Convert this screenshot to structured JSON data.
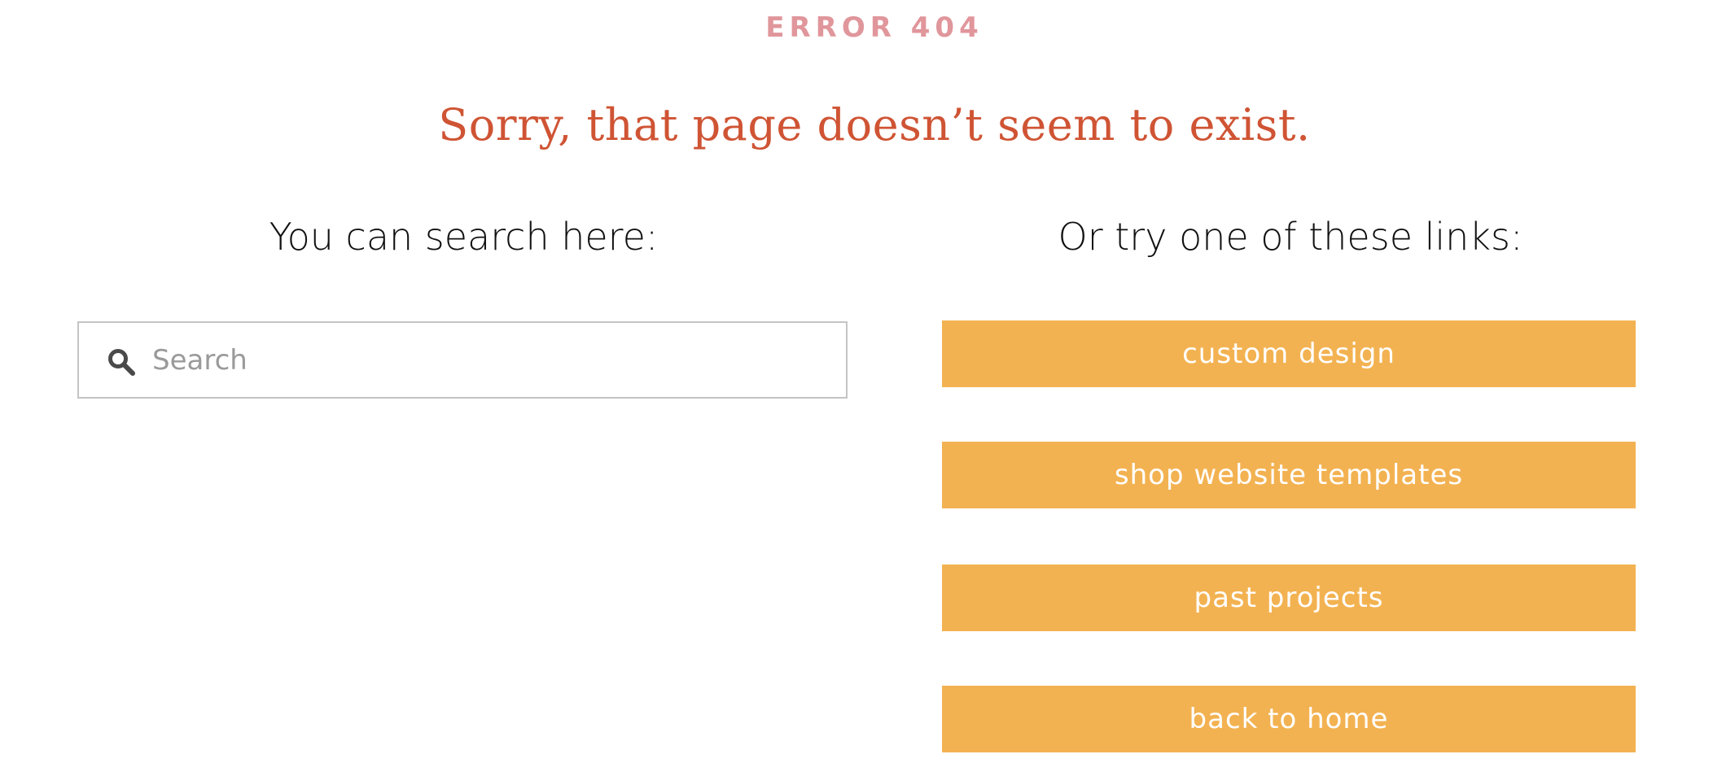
{
  "error": {
    "code_label": "ERROR 404"
  },
  "headline": "Sorry, that page doesn’t seem to exist.",
  "search_section": {
    "heading": "You can search here:",
    "placeholder": "Search",
    "value": "",
    "icon": "search-icon"
  },
  "links_section": {
    "heading": "Or try one of these links:",
    "links": [
      {
        "label": "custom design"
      },
      {
        "label": "shop website templates"
      },
      {
        "label": "past projects"
      },
      {
        "label": "back to home"
      }
    ]
  },
  "colors": {
    "error_code": "#e0969b",
    "headline": "#cf5434",
    "button_bg": "#f3b251",
    "button_text": "#ffffff",
    "search_border": "#c4c4c4"
  }
}
